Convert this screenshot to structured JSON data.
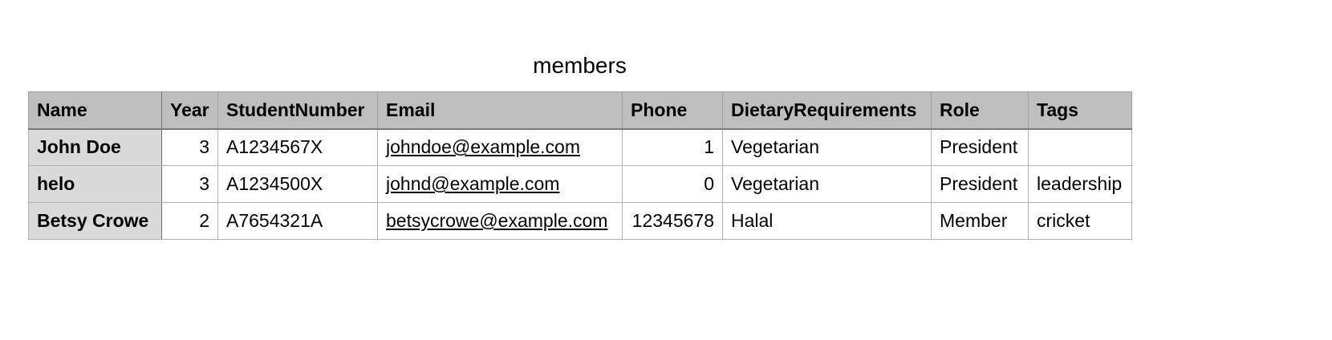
{
  "title": "members",
  "columns": [
    "Name",
    "Year",
    "StudentNumber",
    "Email",
    "Phone",
    "DietaryRequirements",
    "Role",
    "Tags"
  ],
  "rows": [
    {
      "name": "John Doe",
      "year": "3",
      "student_number": "A1234567X",
      "email": "johndoe@example.com",
      "phone": "1",
      "dietary": "Vegetarian",
      "role": "President",
      "tags": ""
    },
    {
      "name": "helo",
      "year": "3",
      "student_number": "A1234500X",
      "email": "johnd@example.com",
      "phone": "0",
      "dietary": "Vegetarian",
      "role": "President",
      "tags": "leadership"
    },
    {
      "name": "Betsy Crowe",
      "year": "2",
      "student_number": "A7654321A",
      "email": "betsycrowe@example.com",
      "phone": "12345678",
      "dietary": "Halal",
      "role": "Member",
      "tags": "cricket"
    }
  ],
  "colors": {
    "header_bg": "#bdbebd",
    "row_header_bg": "#dadada",
    "grid": "#b3b3b3"
  }
}
